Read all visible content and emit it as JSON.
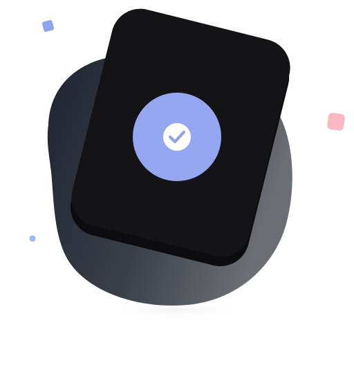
{
  "illustration": {
    "description_icon": "check-icon",
    "colors": {
      "background": "#ffffff",
      "blob_dark": "#1f2430",
      "blob_light": "#6b6e73",
      "card": "#141416",
      "card_edge": "#0c0c0e",
      "badge": "#94a7f0",
      "check_circle": "#ffffff",
      "check_mark": "#8ea2ec",
      "confetti_blue": "#8fa3f0",
      "confetti_pink": "#f7b9bf",
      "confetti_dot": "#9db9f5"
    }
  }
}
